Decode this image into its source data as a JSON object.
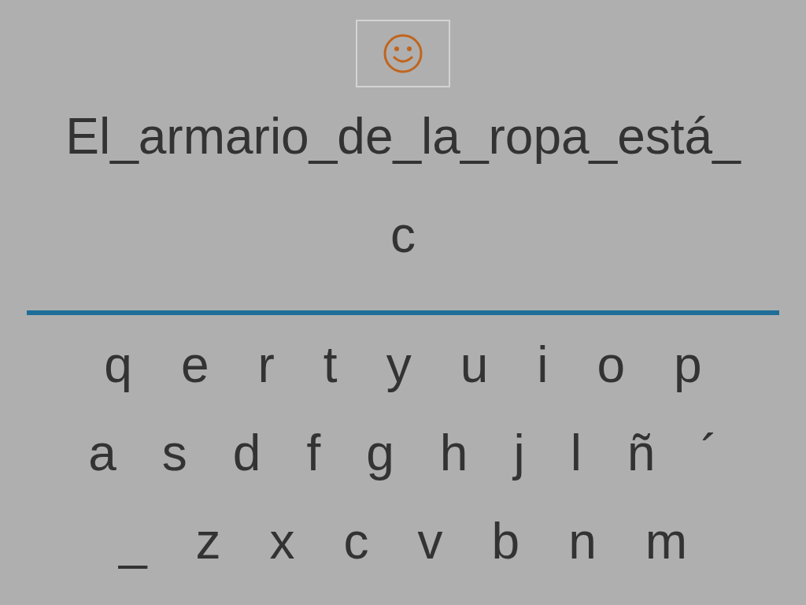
{
  "sentence_lines": [
    "El_armario_de_la_ropa_está_",
    "c"
  ],
  "keyboard_rows": [
    [
      "q",
      "e",
      "r",
      "t",
      "y",
      "u",
      "i",
      "o",
      "p"
    ],
    [
      "a",
      "s",
      "d",
      "f",
      "g",
      "h",
      "j",
      "l",
      "ñ",
      "´"
    ],
    [
      "_",
      "z",
      "x",
      "c",
      "v",
      "b",
      "n",
      "m"
    ]
  ]
}
